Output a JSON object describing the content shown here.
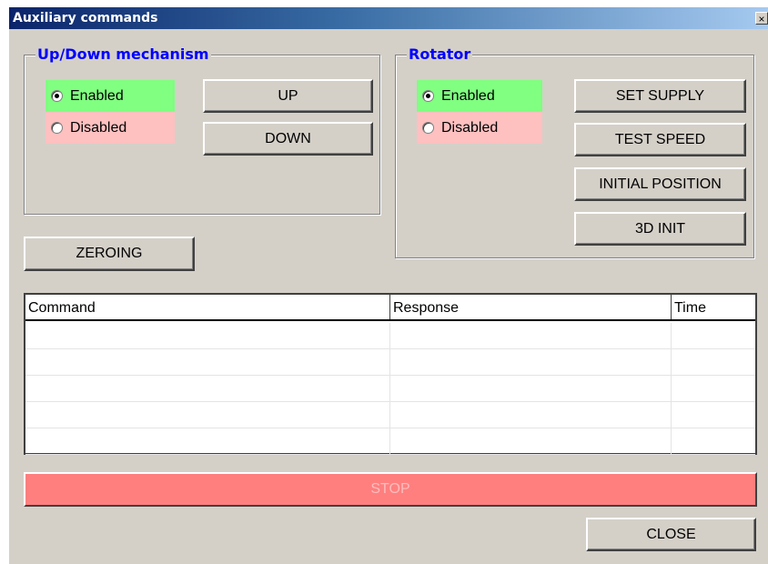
{
  "window": {
    "title": "Auxiliary commands",
    "close_glyph": "×"
  },
  "updown": {
    "legend": "Up/Down mechanism",
    "enabled_label": "Enabled",
    "disabled_label": "Disabled",
    "selected": "enabled",
    "up_label": "UP",
    "down_label": "DOWN"
  },
  "rotator": {
    "legend": "Rotator",
    "enabled_label": "Enabled",
    "disabled_label": "Disabled",
    "selected": "enabled",
    "set_supply_label": "SET SUPPLY",
    "test_speed_label": "TEST SPEED",
    "initial_position_label": "INITIAL POSITION",
    "init3d_label": "3D INIT"
  },
  "zeroing_label": "ZEROING",
  "table": {
    "columns": [
      "Command",
      "Response",
      "Time"
    ],
    "rows": [
      [
        "",
        "",
        ""
      ],
      [
        "",
        "",
        ""
      ],
      [
        "",
        "",
        ""
      ],
      [
        "",
        "",
        ""
      ],
      [
        "",
        "",
        ""
      ]
    ]
  },
  "stop_label": "STOP",
  "close_label": "CLOSE",
  "colors": {
    "enabled_bg": "#80ff80",
    "disabled_bg": "#ffc0c0",
    "stop_bg": "#ff7f7f",
    "legend_text": "#0000ff",
    "titlebar": "#0a246a"
  }
}
